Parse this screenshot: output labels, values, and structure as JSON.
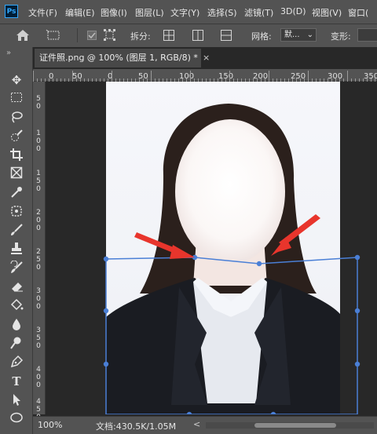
{
  "app": {
    "logo": "Ps"
  },
  "menu": [
    "文件(F)",
    "编辑(E)",
    "图像(I)",
    "图层(L)",
    "文字(Y)",
    "选择(S)",
    "滤镜(T)",
    "3D(D)",
    "视图(V)",
    "窗口("
  ],
  "options": {
    "split_label": "拆分:",
    "grid_label": "网格:",
    "grid_value": "默...",
    "transform_label": "变形:"
  },
  "document": {
    "tab_title": "证件照.png @ 100% (图层 1, RGB/8) *",
    "close_symbol": "×"
  },
  "rulers": {
    "horizontal": [
      "0",
      "50",
      "0",
      "50",
      "100",
      "150",
      "200",
      "250",
      "300",
      "350"
    ],
    "vertical": [
      "5\n0",
      "1\n0\n0",
      "1\n5\n0",
      "2\n0\n0",
      "2\n5\n0",
      "3\n0\n0",
      "3\n5\n0",
      "4\n0\n0",
      "4\n5\n0"
    ]
  },
  "status": {
    "zoom": "100%",
    "doc_info": "文档:430.5K/1.05M",
    "scroll_arrow": "<"
  },
  "colors": {
    "ui_bg": "#535353",
    "canvas_bg": "#282828",
    "warp_grid": "#4a7fd6",
    "arrow": "#e8352c",
    "suit": "#1a1c22",
    "shirt": "#e6e9ef",
    "hair": "#2b201c"
  },
  "icons": {
    "toolbar": [
      "move-icon",
      "marquee-icon",
      "lasso-icon",
      "quick-select-icon",
      "crop-icon",
      "frame-icon",
      "eyedropper-icon",
      "healing-icon",
      "brush-icon",
      "stamp-icon",
      "history-brush-icon",
      "eraser-icon",
      "paint-bucket-icon",
      "blur-icon",
      "dodge-icon",
      "pen-icon",
      "type-icon",
      "path-select-icon",
      "shape-icon"
    ]
  }
}
